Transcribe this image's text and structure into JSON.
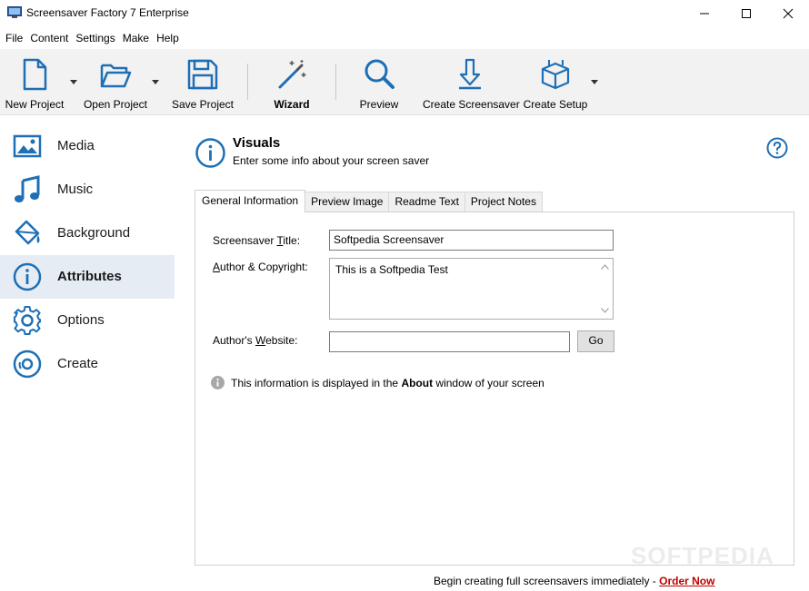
{
  "window": {
    "title": "Screensaver Factory 7 Enterprise"
  },
  "menu": [
    "File",
    "Content",
    "Settings",
    "Make",
    "Help"
  ],
  "toolbar": {
    "new_project": "New Project",
    "open_project": "Open Project",
    "save_project": "Save Project",
    "wizard": "Wizard",
    "preview": "Preview",
    "create_screensaver": "Create Screensaver",
    "create_setup": "Create Setup"
  },
  "sidebar": {
    "items": [
      {
        "label": "Media",
        "icon": "media-icon"
      },
      {
        "label": "Music",
        "icon": "music-icon"
      },
      {
        "label": "Background",
        "icon": "paint-bucket-icon"
      },
      {
        "label": "Attributes",
        "icon": "info-icon"
      },
      {
        "label": "Options",
        "icon": "gear-icon"
      },
      {
        "label": "Create",
        "icon": "disc-icon"
      }
    ],
    "active": "Attributes"
  },
  "header": {
    "title": "Visuals",
    "subtitle": "Enter some info about your screen saver"
  },
  "tabs": [
    "General Information",
    "Preview Image",
    "Readme Text",
    "Project Notes"
  ],
  "form": {
    "title_label_pre": "Screensaver ",
    "title_label_ul": "T",
    "title_label_post": "itle:",
    "title_value": "Softpedia Screensaver",
    "author_label_pre": "",
    "author_label_ul": "A",
    "author_label_post": "uthor & Copyright:",
    "author_value": "This is a Softpedia Test",
    "website_label_pre": "Author's ",
    "website_label_ul": "W",
    "website_label_post": "ebsite:",
    "website_value": "",
    "go_label": "Go",
    "info_pre": "This information is displayed in the ",
    "info_bold": "About",
    "info_post": " window of your screen"
  },
  "footer": {
    "text": "Begin creating full screensavers immediately - ",
    "link": "Order Now"
  },
  "watermark": "SOFTPEDIA",
  "colors": {
    "accent": "#1e6fb5",
    "active_bg": "#e6ecf4",
    "order_link": "#c00000"
  }
}
